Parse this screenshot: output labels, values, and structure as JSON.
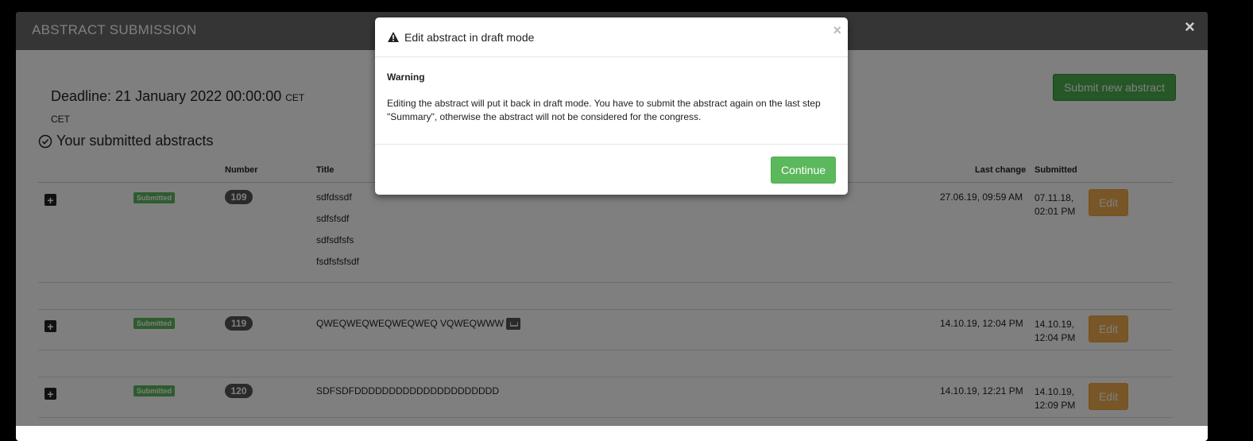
{
  "panel": {
    "title": "ABSTRACT SUBMISSION",
    "close_label": "×",
    "deadline_label": "Deadline: 21 January 2022 00:00:00",
    "deadline_tz_inline": "CET",
    "deadline_tz_line": "CET",
    "submit_new_label": "Submit new abstract",
    "section_title": "Your submitted abstracts",
    "columns": {
      "number": "Number",
      "title": "Title",
      "last_change": "Last change",
      "submitted": "Submitted"
    }
  },
  "rows": [
    {
      "expand": "+",
      "status": "Submitted",
      "number": "109",
      "titles": [
        "sdfdssdf",
        "sdfsfsdf",
        "sdfsdfsfs",
        "fsdfsfsfsdf"
      ],
      "last_change": "27.06.19, 09:59 AM",
      "submitted_date": "07.11.18,",
      "submitted_time": "02:01 PM",
      "edit_label": "Edit"
    },
    {
      "expand": "+",
      "status": "Submitted",
      "number": "119",
      "titles": [
        "QWEQWEQWEQWEQWEQ VQWEQWWW"
      ],
      "last_change": "14.10.19, 12:04 PM",
      "submitted_date": "14.10.19,",
      "submitted_time": "12:04 PM",
      "edit_label": "Edit"
    },
    {
      "expand": "+",
      "status": "Submitted",
      "number": "120",
      "titles": [
        "SDFSDFDDDDDDDDDDDDDDDDDDDDD"
      ],
      "last_change": "14.10.19, 12:21 PM",
      "submitted_date": "14.10.19,",
      "submitted_time": "12:09 PM",
      "edit_label": "Edit"
    }
  ],
  "modal": {
    "title": "Edit abstract in draft mode",
    "close_label": "×",
    "warning": "Warning",
    "text": "Editing the abstract will put it back in draft mode. You have to submit the abstract again on the last step \"Summary\", otherwise the abstract will not be considered for the congress.",
    "continue_label": "Continue"
  }
}
